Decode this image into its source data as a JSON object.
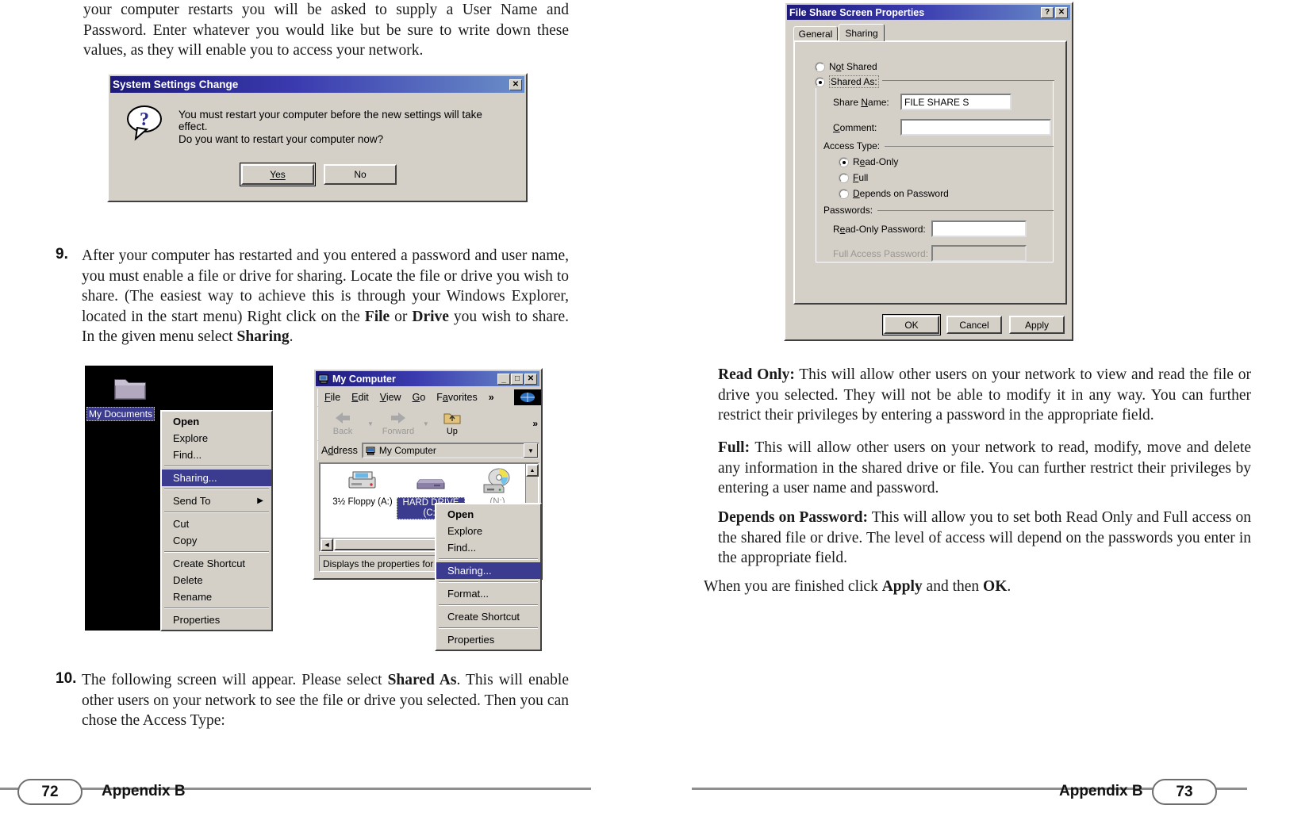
{
  "document": {
    "left_page": {
      "paragraph_top": "your computer restarts you will be asked to supply a User Name and Password. Enter whatever you would like but be sure to write down these values, as they will enable you to access your network.",
      "step9": {
        "number": "9.",
        "text_1": "After your computer has restarted and you entered a password and user name, you must enable a file or drive for sharing. Locate the file or drive you wish to share. (The easiest way to achieve this is through your Windows Explorer, located in the start menu) Right click on the ",
        "bold_1": "File",
        "text_2": " or ",
        "bold_2": "Drive",
        "text_3": " you wish to share. In the given menu select ",
        "bold_3": "Sharing",
        "text_4": "."
      },
      "step10": {
        "number": "10.",
        "text_1": "The following screen will appear. Please select ",
        "bold_1": "Shared As",
        "text_2": ". This will enable other users on your network to see the file or drive you selected. Then  you can chose the Access Type:"
      },
      "footer": {
        "page_number": "72",
        "label": "Appendix B"
      }
    },
    "right_page": {
      "read_only": {
        "term": "Read Only:",
        "text": " This will allow other users on your network to view and read the file or drive you selected. They will not be able to modify it in any way. You can further restrict their privileges by entering a password in the appropriate field."
      },
      "full": {
        "term": "Full:",
        "text": " This will allow other users on your network to read, modify, move and delete any information in the shared drive or file. You can further restrict their privileges by entering a user name and password."
      },
      "depends": {
        "term": "Depends on Password:",
        "text": " This will allow you to set both Read Only and Full access on the shared file or drive. The level of access will depend on the passwords you enter in the appropriate field."
      },
      "closing": {
        "text_1": "When you are finished click ",
        "bold_1": "Apply",
        "text_2": " and then ",
        "bold_2": "OK",
        "text_3": "."
      },
      "footer": {
        "page_number": "73",
        "label": "Appendix B"
      }
    }
  },
  "system_settings_dialog": {
    "title": "System Settings Change",
    "close_label": "✕",
    "icon": "question-mark-icon",
    "line1": "You must restart your computer before the new settings will take effect.",
    "line2": "Do you want to restart your computer now?",
    "yes_label": "Yes",
    "no_label": "No"
  },
  "desktop_screenshot": {
    "icon_label": "My Documents",
    "context_menu": [
      {
        "label": "Open",
        "bold": true,
        "selected": false,
        "submenu": false
      },
      {
        "label": "Explore",
        "bold": false,
        "selected": false,
        "submenu": false
      },
      {
        "label": "Find...",
        "bold": false,
        "selected": false,
        "submenu": false
      },
      {
        "separator": true
      },
      {
        "label": "Sharing...",
        "bold": false,
        "selected": true,
        "submenu": false
      },
      {
        "separator": true
      },
      {
        "label": "Send To",
        "bold": false,
        "selected": false,
        "submenu": true
      },
      {
        "separator": true
      },
      {
        "label": "Cut",
        "bold": false,
        "selected": false,
        "submenu": false
      },
      {
        "label": "Copy",
        "bold": false,
        "selected": false,
        "submenu": false
      },
      {
        "separator": true
      },
      {
        "label": "Create Shortcut",
        "bold": false,
        "selected": false,
        "submenu": false
      },
      {
        "label": "Delete",
        "bold": false,
        "selected": false,
        "submenu": false
      },
      {
        "label": "Rename",
        "bold": false,
        "selected": false,
        "submenu": false
      },
      {
        "separator": true
      },
      {
        "label": "Properties",
        "bold": false,
        "selected": false,
        "submenu": false
      }
    ]
  },
  "my_computer_window": {
    "title": "My Computer",
    "title_icon": "computer-icon",
    "window_buttons": {
      "minimize": "_",
      "maximize": "□",
      "close": "✕"
    },
    "menu": [
      "File",
      "Edit",
      "View",
      "Go",
      "Favorites"
    ],
    "menu_overflow": "»",
    "toolbar": [
      {
        "label": "Back",
        "icon": "arrow-left-icon",
        "disabled": true
      },
      {
        "label": "Forward",
        "icon": "arrow-right-icon",
        "disabled": true
      },
      {
        "label": "Up",
        "icon": "folder-up-icon",
        "disabled": false
      }
    ],
    "toolbar_overflow": "»",
    "address_label": "Address",
    "address_value": "My Computer",
    "drives": [
      {
        "label": "3½ Floppy (A:)",
        "icon": "floppy-drive-icon",
        "selected": false
      },
      {
        "label": "HARD DRIVE (C:)",
        "icon": "hard-drive-icon",
        "selected": true
      },
      {
        "label": "(N:)",
        "icon": "cd-drive-icon",
        "selected": false
      }
    ],
    "status_text": "Displays the properties for sh",
    "context_menu": [
      {
        "label": "Open",
        "bold": true,
        "selected": false
      },
      {
        "label": "Explore",
        "bold": false,
        "selected": false
      },
      {
        "label": "Find...",
        "bold": false,
        "selected": false
      },
      {
        "separator": true
      },
      {
        "label": "Sharing...",
        "bold": false,
        "selected": true
      },
      {
        "separator": true
      },
      {
        "label": "Format...",
        "bold": false,
        "selected": false
      },
      {
        "separator": true
      },
      {
        "label": "Create Shortcut",
        "bold": false,
        "selected": false
      },
      {
        "separator": true
      },
      {
        "label": "Properties",
        "bold": false,
        "selected": false
      }
    ]
  },
  "file_share_dialog": {
    "title": "File Share Screen Properties",
    "help_label": "?",
    "close_label": "✕",
    "tabs": [
      {
        "label": "General",
        "active": false
      },
      {
        "label": "Sharing",
        "active": true
      }
    ],
    "share_mode": [
      {
        "label": "Not Shared",
        "selected": false
      },
      {
        "label": "Shared As:",
        "selected": true
      }
    ],
    "share_name_label": "Share Name:",
    "share_name_value": "FILE SHARE S",
    "comment_label": "Comment:",
    "comment_value": "",
    "access_type_label": "Access Type:",
    "access_types": [
      {
        "label": "Read-Only",
        "selected": true
      },
      {
        "label": "Full",
        "selected": false
      },
      {
        "label": "Depends on Password",
        "selected": false
      }
    ],
    "passwords_label": "Passwords:",
    "read_only_password_label": "Read-Only Password:",
    "read_only_password_value": "",
    "full_access_password_label": "Full Access Password:",
    "full_access_password_value": "",
    "buttons": [
      {
        "label": "OK",
        "default": true
      },
      {
        "label": "Cancel",
        "default": false
      },
      {
        "label": "Apply",
        "default": false
      }
    ]
  },
  "colors": {
    "title_bar_start": "#1d1a7a",
    "title_bar_end": "#6a8ec8",
    "dialog_face": "#d4d0c8",
    "selection": "#3b3b8f",
    "footer_rule": "#8f8f8f"
  }
}
